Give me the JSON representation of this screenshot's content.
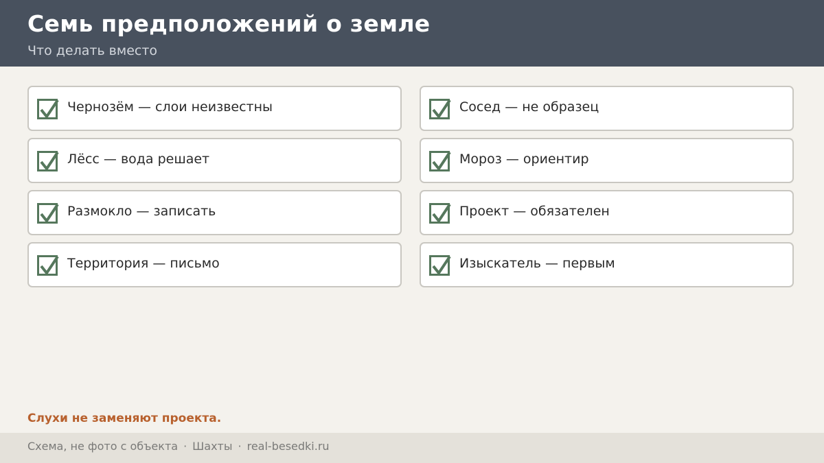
{
  "header": {
    "title": "Семь предположений о земле",
    "subtitle": "Что делать вместо"
  },
  "items": [
    {
      "label": "Чернозём — слои неизвестны",
      "checked": true
    },
    {
      "label": "Сосед — не образец",
      "checked": true
    },
    {
      "label": "Лёсс — вода решает",
      "checked": true
    },
    {
      "label": "Мороз — ориентир",
      "checked": true
    },
    {
      "label": "Размокло — записать",
      "checked": true
    },
    {
      "label": "Проект — обязателен",
      "checked": true
    },
    {
      "label": "Территория — письмо",
      "checked": true
    },
    {
      "label": "Изыскатель — первым",
      "checked": true
    }
  ],
  "note": "Слухи не заменяют проекта.",
  "footer": {
    "part1": "Схема, не фото с объекта",
    "separator": "·",
    "part2": "Шахты",
    "part3": "real-besedki.ru"
  },
  "colors": {
    "header_bg": "#48515e",
    "accent_green": "#55775c",
    "note_orange": "#b8612e"
  },
  "icons": {
    "item": "checkbox-checked-icon"
  }
}
